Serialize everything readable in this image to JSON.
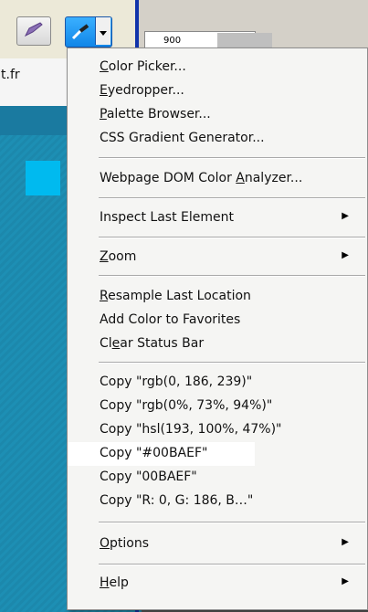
{
  "background": {
    "url_fragment": "t.fr",
    "ruler_value": "900",
    "swatch_color": "#00BAEF"
  },
  "toolbar": {
    "pen_icon": "pen-icon",
    "picker_icon": "eyedropper-icon",
    "dropdown_icon": "chevron-down-icon"
  },
  "menu": {
    "items": [
      {
        "label": "Color Picker...",
        "ul": "C",
        "rest": "olor Picker..."
      },
      {
        "label": "Eyedropper...",
        "ul": "E",
        "rest": "yedropper..."
      },
      {
        "label": "Palette Browser...",
        "ul": "P",
        "rest": "alette Browser..."
      },
      {
        "label": "CSS Gradient Generator..."
      },
      {
        "label": "Webpage DOM Color Analyzer...",
        "pre": "Webpage DOM Color ",
        "ul": "A",
        "rest": "nalyzer..."
      },
      {
        "label": "Inspect Last Element"
      },
      {
        "label": "Zoom",
        "ul": "Z",
        "rest": "oom"
      },
      {
        "label": "Resample Last Location",
        "ul": "R",
        "rest": "esample Last Location"
      },
      {
        "label": "Add Color to Favorites"
      },
      {
        "label": "Clear Status Bar",
        "pre": "Cl",
        "ul": "e",
        "rest": "ar Status Bar"
      },
      {
        "label": "Copy \"rgb(0, 186, 239)\""
      },
      {
        "label": "Copy \"rgb(0%, 73%, 94%)\""
      },
      {
        "label": "Copy \"hsl(193, 100%, 47%)\""
      },
      {
        "label": "Copy \"#00BAEF\""
      },
      {
        "label": "Copy \"00BAEF\""
      },
      {
        "label": "Copy \"R: 0, G: 186, B…\""
      },
      {
        "label": "Options",
        "ul": "O",
        "rest": "ptions"
      },
      {
        "label": "Help",
        "ul": "H",
        "rest": "elp"
      }
    ]
  }
}
